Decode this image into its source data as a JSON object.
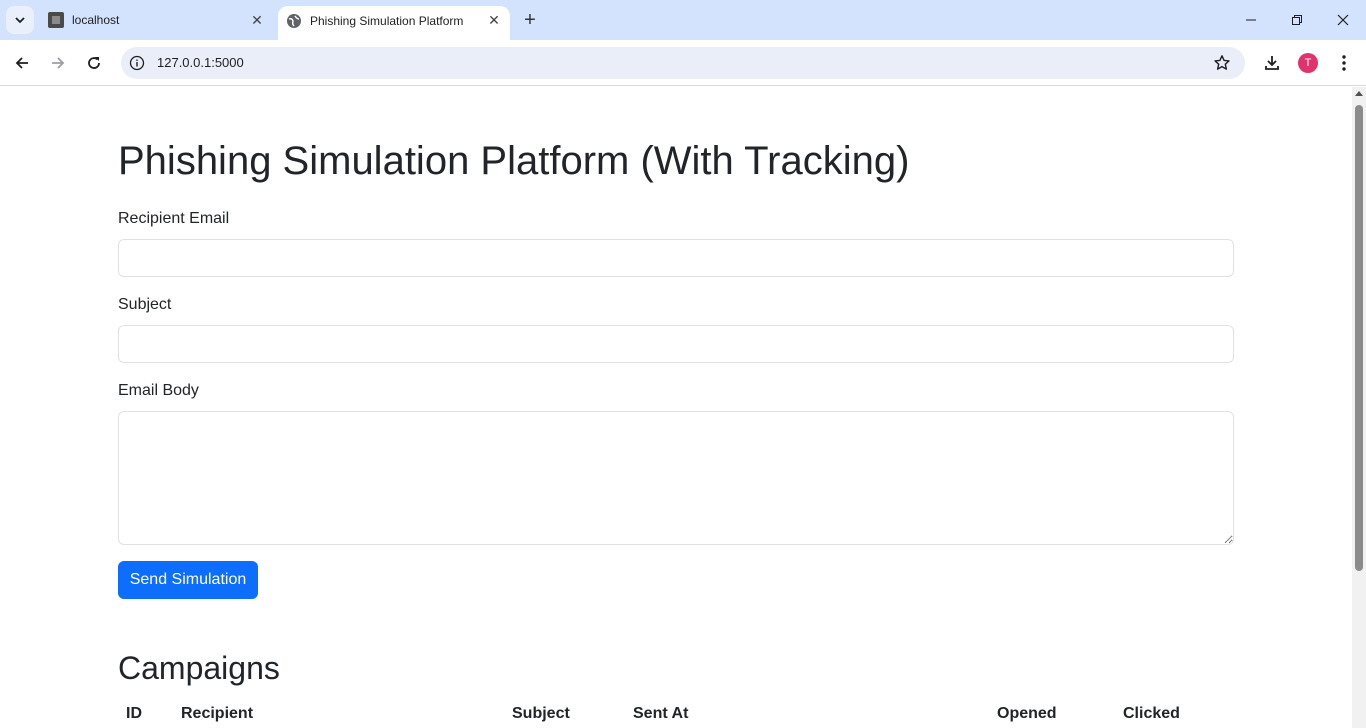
{
  "browser": {
    "tabs": [
      {
        "title": "localhost",
        "active": false
      },
      {
        "title": "Phishing Simulation Platform",
        "active": true
      }
    ],
    "address": "127.0.0.1:5000",
    "profile_initial": "T",
    "profile_color": "#e0336c"
  },
  "page": {
    "title": "Phishing Simulation Platform (With Tracking)",
    "form": {
      "recipient_label": "Recipient Email",
      "recipient_value": "",
      "subject_label": "Subject",
      "subject_value": "",
      "body_label": "Email Body",
      "body_value": "",
      "submit_label": "Send Simulation"
    },
    "campaigns": {
      "title": "Campaigns",
      "columns": [
        "ID",
        "Recipient",
        "Subject",
        "Sent At",
        "Opened",
        "Clicked"
      ]
    }
  },
  "colors": {
    "primary": "#0d6efd",
    "tabstrip": "#d3e3fd"
  }
}
